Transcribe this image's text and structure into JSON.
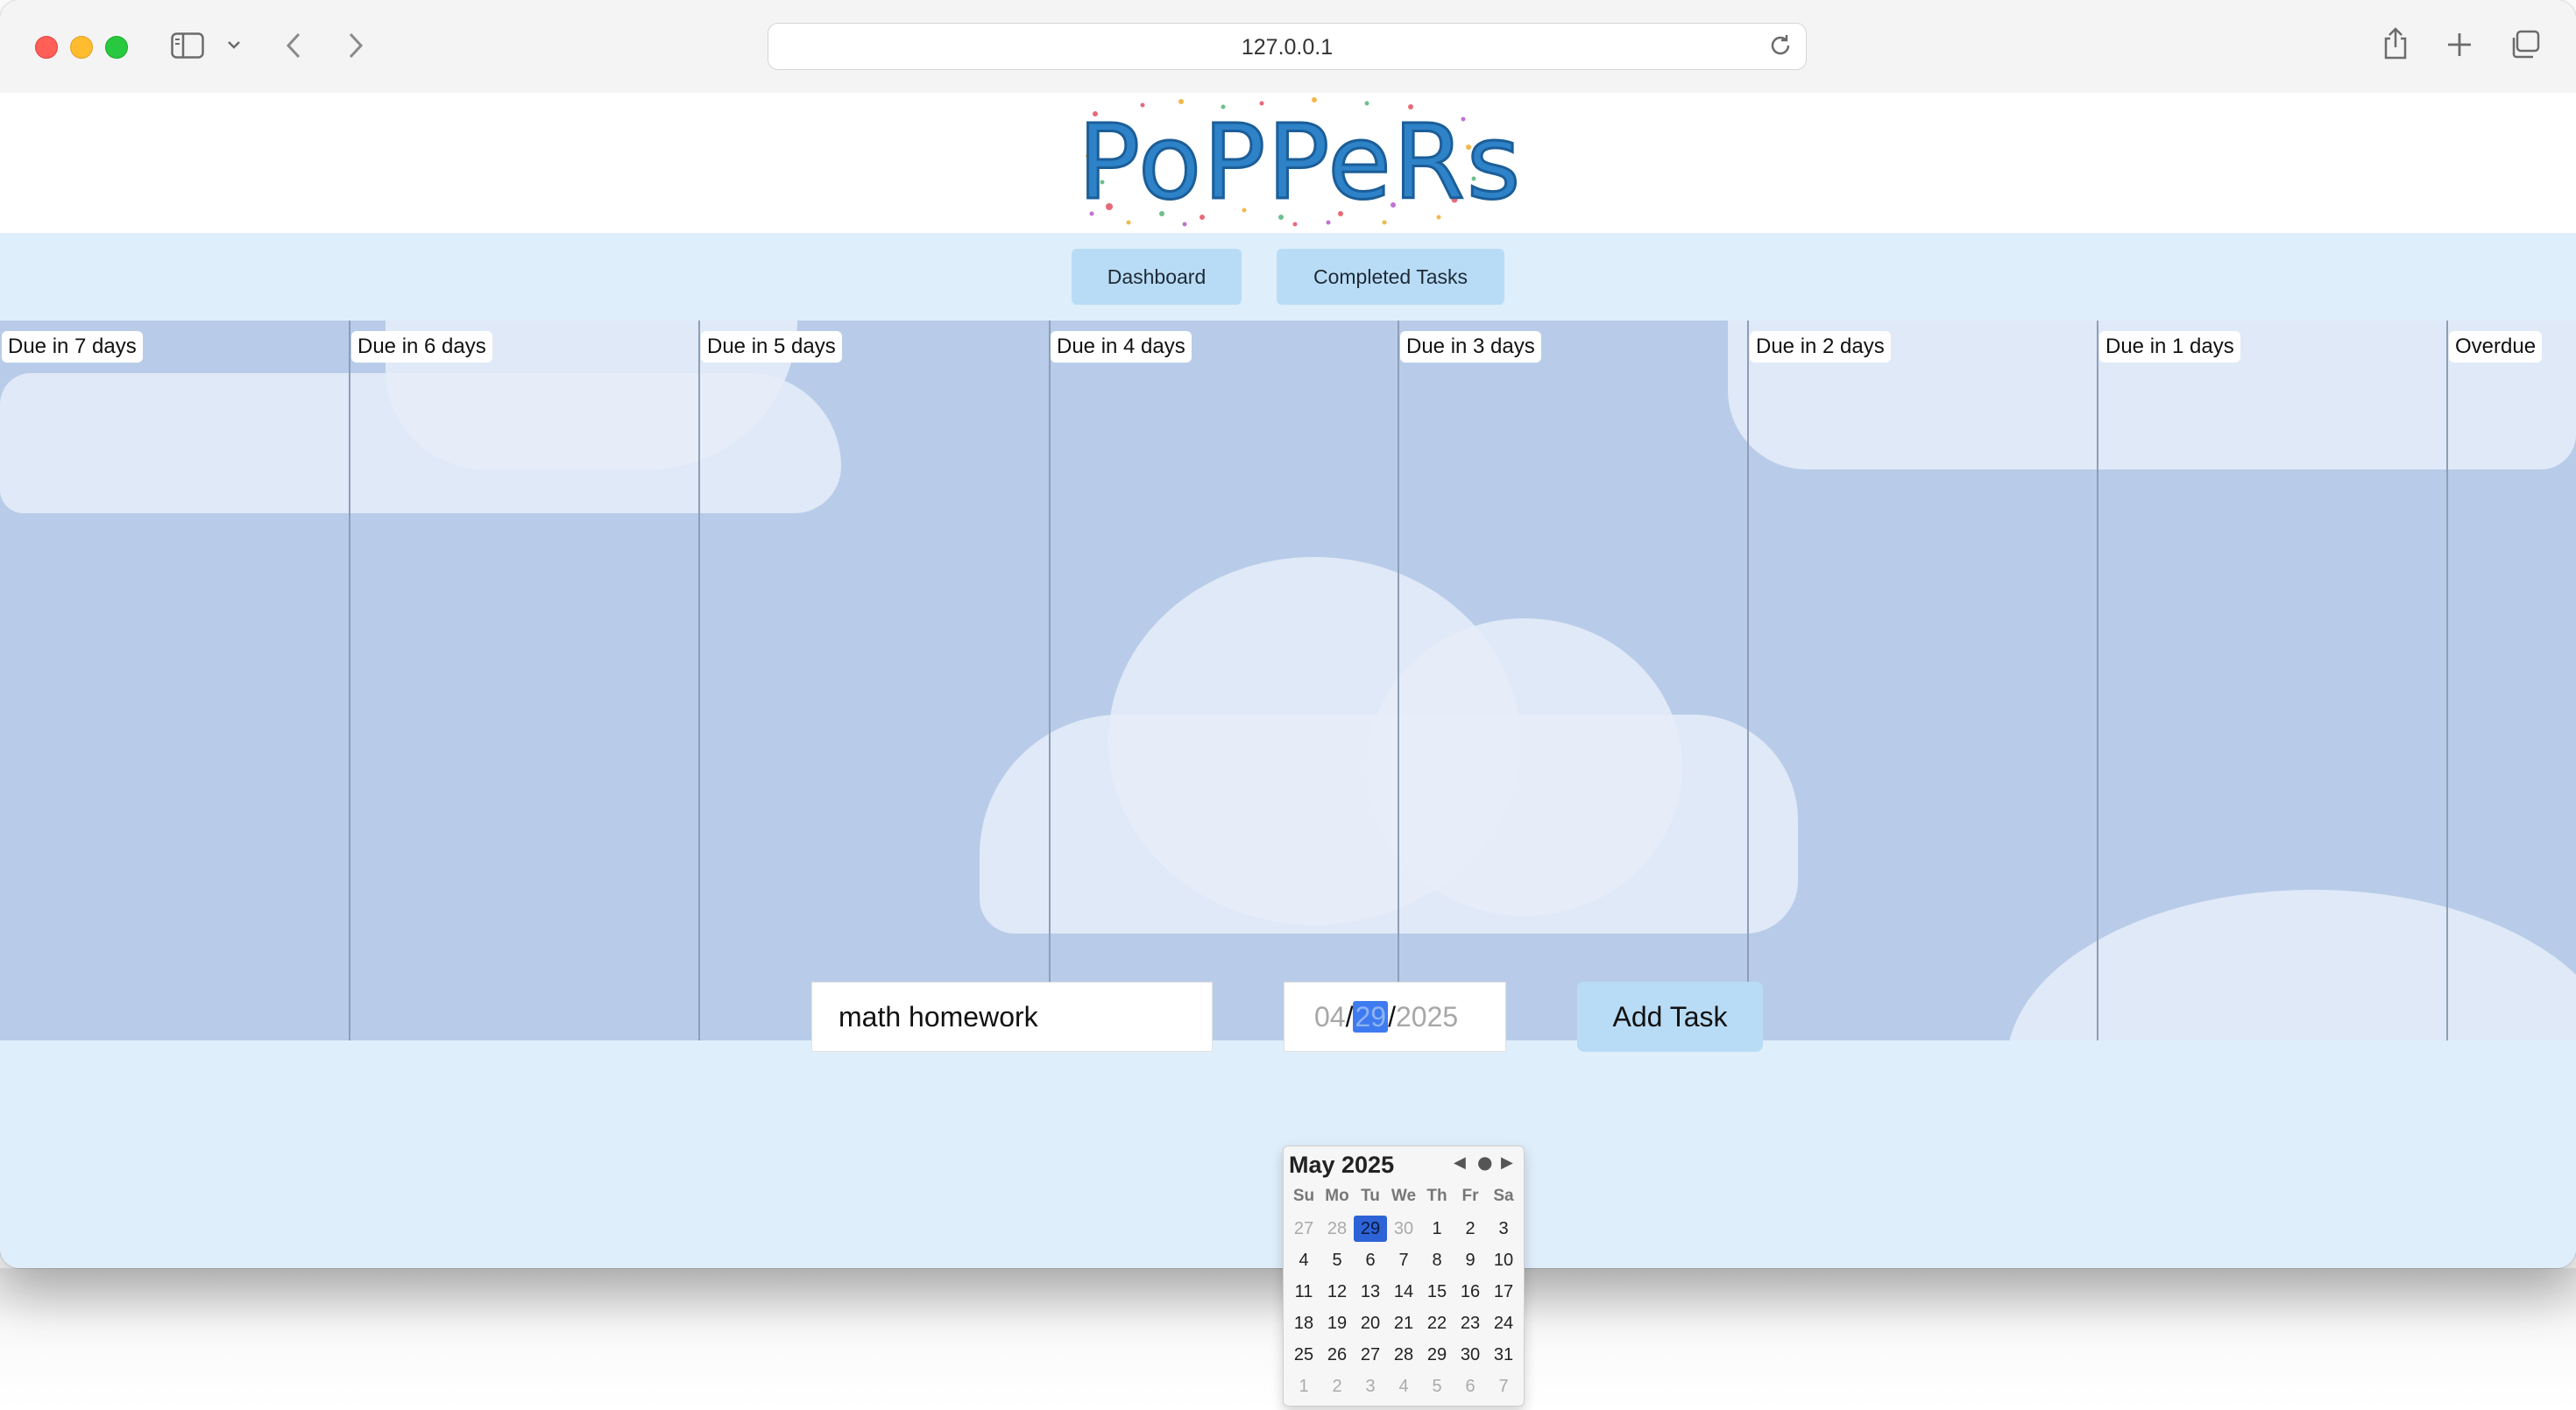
{
  "browser": {
    "url": "127.0.0.1"
  },
  "app": {
    "logo_text": "PoPPeRs"
  },
  "nav": {
    "dashboard": "Dashboard",
    "completed": "Completed Tasks"
  },
  "columns": [
    {
      "label": "Due in 7 days"
    },
    {
      "label": "Due in 6 days"
    },
    {
      "label": "Due in 5 days"
    },
    {
      "label": "Due in 4 days"
    },
    {
      "label": "Due in 3 days"
    },
    {
      "label": "Due in 2 days"
    },
    {
      "label": "Due in 1 days"
    },
    {
      "label": "Overdue"
    }
  ],
  "form": {
    "task_value": "math homework",
    "date_month": "04",
    "date_day": "29",
    "date_year": "2025",
    "add_label": "Add Task"
  },
  "calendar": {
    "title": "May 2025",
    "weekdays": [
      "Su",
      "Mo",
      "Tu",
      "We",
      "Th",
      "Fr",
      "Sa"
    ],
    "weeks": [
      [
        "27",
        "28",
        "29",
        "30",
        "1",
        "2",
        "3"
      ],
      [
        "4",
        "5",
        "6",
        "7",
        "8",
        "9",
        "10"
      ],
      [
        "11",
        "12",
        "13",
        "14",
        "15",
        "16",
        "17"
      ],
      [
        "18",
        "19",
        "20",
        "21",
        "22",
        "23",
        "24"
      ],
      [
        "25",
        "26",
        "27",
        "28",
        "29",
        "30",
        "31"
      ],
      [
        "1",
        "2",
        "3",
        "4",
        "5",
        "6",
        "7"
      ]
    ],
    "selected": "29"
  },
  "colors": {
    "board": "#b8cce9",
    "button": "#b9dcf6",
    "page": "#dfeefb",
    "accent": "#2d63d6"
  }
}
